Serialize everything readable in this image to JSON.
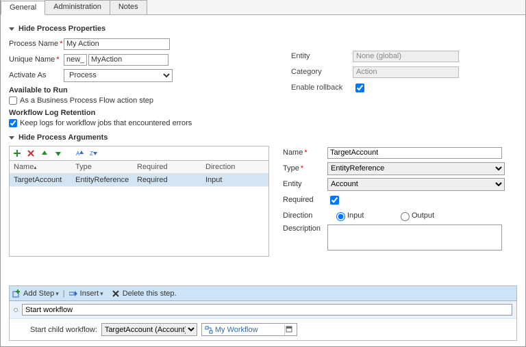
{
  "tabs": {
    "general": "General",
    "admin": "Administration",
    "notes": "Notes"
  },
  "section1": {
    "title": "Hide Process Properties",
    "processNameLabel": "Process Name",
    "processName": "My Action",
    "uniqueNameLabel": "Unique Name",
    "uniquePrefix": "new_",
    "uniqueName": "MyAction",
    "activateAsLabel": "Activate As",
    "activateAs": "Process",
    "availableHeader": "Available to Run",
    "bpfStep": "As a Business Process Flow action step",
    "logHeader": "Workflow Log Retention",
    "logOption": "Keep logs for workflow jobs that encountered errors",
    "entityLabel": "Entity",
    "entity": "None (global)",
    "categoryLabel": "Category",
    "category": "Action",
    "rollbackLabel": "Enable rollback"
  },
  "section2": {
    "title": "Hide Process Arguments",
    "cols": {
      "name": "Name",
      "type": "Type",
      "required": "Required",
      "direction": "Direction"
    },
    "rows": [
      {
        "name": "TargetAccount",
        "type": "EntityReference",
        "required": "Required",
        "direction": "Input"
      }
    ],
    "details": {
      "nameLabel": "Name",
      "name": "TargetAccount",
      "typeLabel": "Type",
      "type": "EntityReference",
      "entityLabel": "Entity",
      "entity": "Account",
      "requiredLabel": "Required",
      "directionLabel": "Direction",
      "inputLabel": "Input",
      "outputLabel": "Output",
      "descLabel": "Description"
    }
  },
  "steps": {
    "addStep": "Add Step",
    "insert": "Insert",
    "deleteStep": "Delete this step.",
    "stepTitle": "Start workflow",
    "childLabel": "Start child workflow:",
    "childEntity": "TargetAccount (Account)",
    "workflowName": "My Workflow"
  }
}
